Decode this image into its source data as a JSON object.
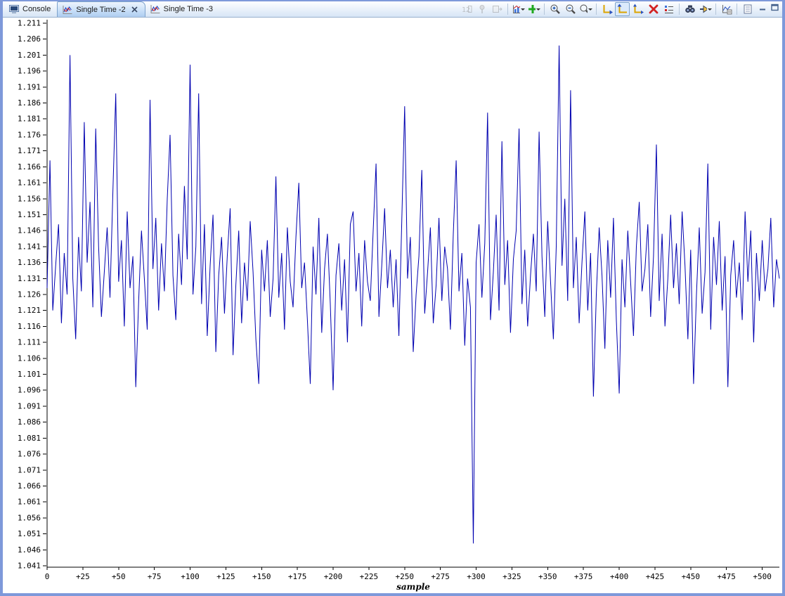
{
  "tabs": [
    {
      "label": "Console",
      "active": false,
      "closable": false
    },
    {
      "label": "Single Time -2",
      "active": true,
      "closable": true
    },
    {
      "label": "Single Time -3",
      "active": false,
      "closable": false
    }
  ],
  "toolbar": {
    "buttons": [
      {
        "name": "display-format-icon",
        "enabled": false
      },
      {
        "name": "pin-graph-icon",
        "enabled": false
      },
      {
        "name": "export-data-icon",
        "enabled": false
      },
      {
        "sep": true
      },
      {
        "name": "graph-type-icon",
        "dropdown": true
      },
      {
        "name": "add-graph-icon",
        "dropdown": true
      },
      {
        "sep": true
      },
      {
        "name": "zoom-in-icon"
      },
      {
        "name": "zoom-out-icon"
      },
      {
        "name": "zoom-mode-icon",
        "dropdown": true
      },
      {
        "sep": true
      },
      {
        "name": "autoscale-x-icon"
      },
      {
        "name": "autoscale-y-icon",
        "pressed": true
      },
      {
        "name": "reset-view-icon"
      },
      {
        "name": "clear-graph-icon"
      },
      {
        "name": "legend-icon"
      },
      {
        "sep": true
      },
      {
        "name": "search-icon"
      },
      {
        "name": "goto-address-icon",
        "dropdown": true
      },
      {
        "sep": true
      },
      {
        "name": "graph-properties-icon"
      },
      {
        "sep": true
      },
      {
        "name": "view-menu-icon"
      }
    ]
  },
  "window_buttons": {
    "minimize": "minimize",
    "maximize": "maximize"
  },
  "colors": {
    "trace": "#0000b0",
    "frame": "#7e99da",
    "selected_tab": "#bed9f6",
    "plot_background": "#ffffff",
    "axis": "#000000"
  },
  "chart_data": {
    "type": "line",
    "title": "Single Time -2",
    "xlabel": "sample",
    "ylabel": "",
    "xlim": [
      0,
      512
    ],
    "ylim": [
      1.041,
      1.211
    ],
    "x_step": 2,
    "grid": false,
    "legend": "none",
    "x_tick_values": [
      0,
      25,
      50,
      75,
      100,
      125,
      150,
      175,
      200,
      225,
      250,
      275,
      300,
      325,
      350,
      375,
      400,
      425,
      450,
      475,
      500
    ],
    "x_tick_labels": [
      "0",
      "+25",
      "+50",
      "+75",
      "+100",
      "+125",
      "+150",
      "+175",
      "+200",
      "+225",
      "+250",
      "+275",
      "+300",
      "+325",
      "+350",
      "+375",
      "+400",
      "+425",
      "+450",
      "+475",
      "+500"
    ],
    "y_tick_labels": [
      "1.211",
      "1.206",
      "1.201",
      "1.196",
      "1.191",
      "1.186",
      "1.181",
      "1.176",
      "1.171",
      "1.166",
      "1.161",
      "1.156",
      "1.151",
      "1.146",
      "1.141",
      "1.136",
      "1.131",
      "1.126",
      "1.121",
      "1.116",
      "1.111",
      "1.106",
      "1.101",
      "1.096",
      "1.091",
      "1.086",
      "1.081",
      "1.076",
      "1.071",
      "1.066",
      "1.061",
      "1.056",
      "1.051",
      "1.046",
      "1.041"
    ],
    "series": [
      {
        "name": "Single Time -2",
        "color": "#0000b0",
        "values": [
          1.128,
          1.168,
          1.121,
          1.135,
          1.148,
          1.117,
          1.139,
          1.126,
          1.201,
          1.131,
          1.112,
          1.144,
          1.127,
          1.18,
          1.136,
          1.155,
          1.122,
          1.178,
          1.141,
          1.119,
          1.133,
          1.147,
          1.125,
          1.158,
          1.189,
          1.13,
          1.143,
          1.116,
          1.152,
          1.128,
          1.138,
          1.097,
          1.124,
          1.146,
          1.131,
          1.115,
          1.187,
          1.134,
          1.15,
          1.121,
          1.142,
          1.127,
          1.156,
          1.176,
          1.132,
          1.118,
          1.145,
          1.129,
          1.16,
          1.137,
          1.198,
          1.126,
          1.141,
          1.189,
          1.123,
          1.148,
          1.113,
          1.135,
          1.151,
          1.108,
          1.132,
          1.144,
          1.12,
          1.138,
          1.153,
          1.107,
          1.129,
          1.146,
          1.117,
          1.136,
          1.124,
          1.149,
          1.133,
          1.112,
          1.098,
          1.14,
          1.127,
          1.143,
          1.119,
          1.131,
          1.163,
          1.125,
          1.139,
          1.115,
          1.147,
          1.13,
          1.122,
          1.144,
          1.161,
          1.128,
          1.136,
          1.118,
          1.098,
          1.141,
          1.126,
          1.15,
          1.114,
          1.134,
          1.145,
          1.123,
          1.096,
          1.132,
          1.142,
          1.121,
          1.137,
          1.111,
          1.148,
          1.152,
          1.127,
          1.139,
          1.116,
          1.143,
          1.13,
          1.124,
          1.146,
          1.167,
          1.119,
          1.135,
          1.153,
          1.128,
          1.14,
          1.122,
          1.137,
          1.113,
          1.149,
          1.185,
          1.131,
          1.144,
          1.108,
          1.126,
          1.138,
          1.165,
          1.12,
          1.133,
          1.147,
          1.117,
          1.129,
          1.15,
          1.124,
          1.141,
          1.134,
          1.115,
          1.145,
          1.168,
          1.127,
          1.139,
          1.11,
          1.131,
          1.122,
          1.048,
          1.136,
          1.148,
          1.125,
          1.142,
          1.183,
          1.118,
          1.133,
          1.151,
          1.121,
          1.174,
          1.129,
          1.143,
          1.114,
          1.137,
          1.146,
          1.178,
          1.123,
          1.14,
          1.116,
          1.132,
          1.145,
          1.127,
          1.177,
          1.138,
          1.119,
          1.149,
          1.13,
          1.112,
          1.141,
          1.204,
          1.135,
          1.156,
          1.124,
          1.19,
          1.128,
          1.144,
          1.117,
          1.136,
          1.152,
          1.121,
          1.139,
          1.094,
          1.126,
          1.147,
          1.132,
          1.109,
          1.143,
          1.125,
          1.15,
          1.118,
          1.095,
          1.137,
          1.122,
          1.146,
          1.13,
          1.113,
          1.141,
          1.155,
          1.127,
          1.134,
          1.148,
          1.119,
          1.138,
          1.173,
          1.124,
          1.145,
          1.116,
          1.131,
          1.151,
          1.128,
          1.142,
          1.123,
          1.152,
          1.135,
          1.112,
          1.14,
          1.098,
          1.126,
          1.147,
          1.12,
          1.133,
          1.167,
          1.115,
          1.144,
          1.129,
          1.149,
          1.121,
          1.138,
          1.097,
          1.132,
          1.143,
          1.125,
          1.136,
          1.118,
          1.152,
          1.13,
          1.146,
          1.111,
          1.139,
          1.124,
          1.143,
          1.127,
          1.134,
          1.15,
          1.122,
          1.137,
          1.131
        ]
      }
    ]
  }
}
